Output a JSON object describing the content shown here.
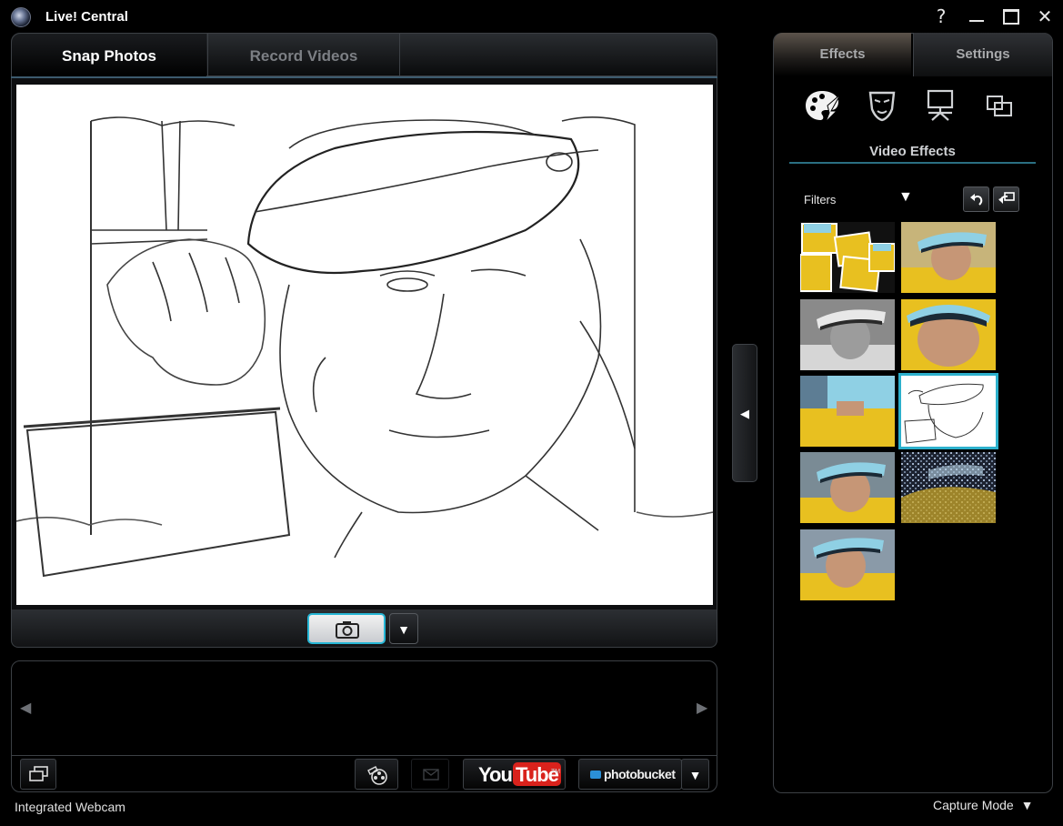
{
  "window": {
    "title": "Live! Central",
    "buttons": {
      "help": "?",
      "minimize": "—",
      "maximize": "☐",
      "close": "✕"
    }
  },
  "left": {
    "tabs": [
      {
        "label": "Snap Photos",
        "active": true
      },
      {
        "label": "Record Videos",
        "active": false
      }
    ],
    "preview": {
      "effect": "sketch"
    },
    "capture": {
      "snap_icon": "camera-icon",
      "dropdown": "▼"
    },
    "gallery": {
      "prev": "◀",
      "next": "▶"
    },
    "toolbar": {
      "youtube_you": "You",
      "youtube_tube": "Tube",
      "youtube_tm": "TM",
      "photobucket": "photobucket",
      "dropdown": "▼"
    },
    "status": "Integrated Webcam"
  },
  "collapse": {
    "arrow": "◀"
  },
  "right": {
    "tabs": [
      {
        "label": "Effects",
        "active": true
      },
      {
        "label": "Settings",
        "active": false
      }
    ],
    "category_icons": [
      "palette-effects-icon",
      "mask-icon",
      "presenter-icon",
      "frames-icon"
    ],
    "heading": "Video Effects",
    "filters_label": "Filters",
    "filters_arrow": "▼",
    "thumbnails": [
      {
        "effect": "collage"
      },
      {
        "effect": "normal"
      },
      {
        "effect": "grayscale"
      },
      {
        "effect": "fisheye"
      },
      {
        "effect": "stretch"
      },
      {
        "effect": "sketch",
        "selected": true
      },
      {
        "effect": "vignette"
      },
      {
        "effect": "pixel-scatter"
      },
      {
        "effect": "normal-2"
      }
    ]
  },
  "footer": {
    "capture_mode": "Capture Mode",
    "capture_mode_arrow": "▼"
  },
  "colors": {
    "accent": "#27b7d6",
    "panel_border": "#3c4045",
    "shirt_yellow": "#e8c020",
    "hat_blue": "#8fd0e4"
  }
}
